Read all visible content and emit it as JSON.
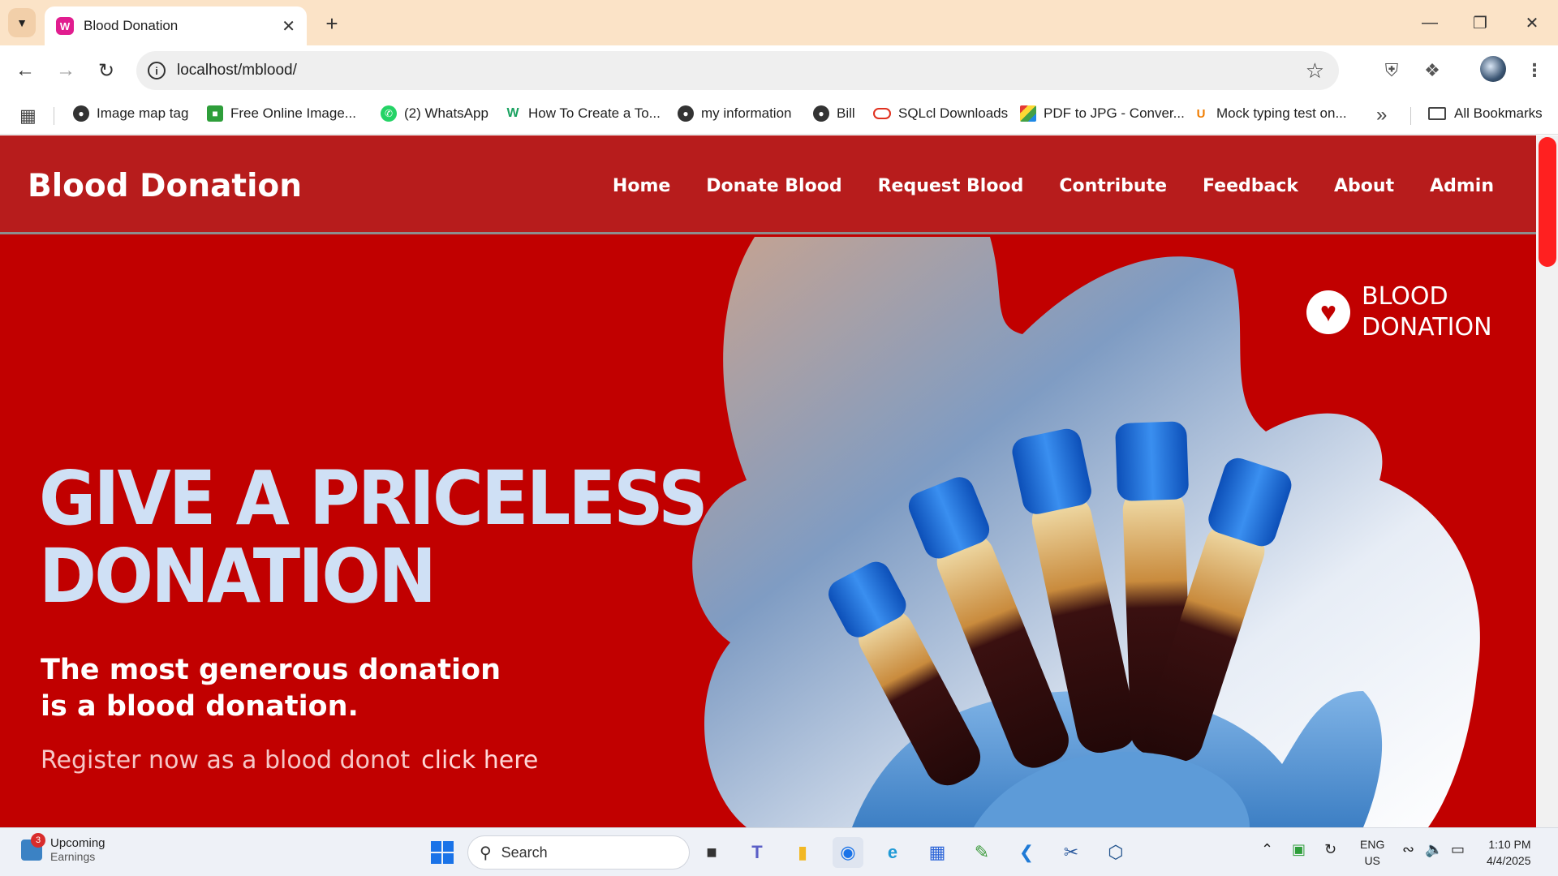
{
  "browser": {
    "tab": {
      "title": "Blood Donation",
      "favicon_text": "W"
    },
    "new_tab_label": "+",
    "url": "localhost/mblood/",
    "bookmarks": [
      {
        "label": "Image map tag",
        "icon": "globe-icon",
        "color": "#333333"
      },
      {
        "label": "Free Online Image...",
        "icon": "image-icon",
        "color": "#2e9e3a"
      },
      {
        "label": "(2) WhatsApp",
        "icon": "whatsapp-icon",
        "color": "#25d366"
      },
      {
        "label": "How To Create a To...",
        "icon": "w3-icon",
        "color": "#1aa260"
      },
      {
        "label": "my information",
        "icon": "globe-icon",
        "color": "#333333"
      },
      {
        "label": "Bill",
        "icon": "globe-icon",
        "color": "#333333"
      },
      {
        "label": "SQLcl Downloads",
        "icon": "oracle-icon",
        "color": "#e0301e"
      },
      {
        "label": "PDF to JPG - Conver...",
        "icon": "pdf-icon",
        "color": "#f4a300"
      },
      {
        "label": "Mock typing test on...",
        "icon": "up-icon",
        "color": "#f07c00"
      }
    ],
    "all_bookmarks": "All Bookmarks"
  },
  "site": {
    "brand": "Blood Donation",
    "nav": [
      "Home",
      "Donate Blood",
      "Request Blood",
      "Contribute",
      "Feedback",
      "About",
      "Admin"
    ],
    "hero": {
      "title_line1": "GIVE A PRICELESS",
      "title_line2": "DONATION",
      "subtitle_line1": "The most generous donation",
      "subtitle_line2": "is a blood donation.",
      "cta_text": "Register now as a blood donot",
      "cta_link": "click here",
      "logo_line1": "BLOOD",
      "logo_line2": "DONATION"
    },
    "colors": {
      "header": "#b71c1c",
      "hero": "#c10000",
      "title": "#cfe0f5"
    }
  },
  "taskbar": {
    "weather_badge": "3",
    "weather_title": "Upcoming",
    "weather_sub": "Earnings",
    "search_placeholder": "Search",
    "lang_1": "ENG",
    "lang_2": "US",
    "time": "1:10 PM",
    "date": "4/4/2025"
  }
}
